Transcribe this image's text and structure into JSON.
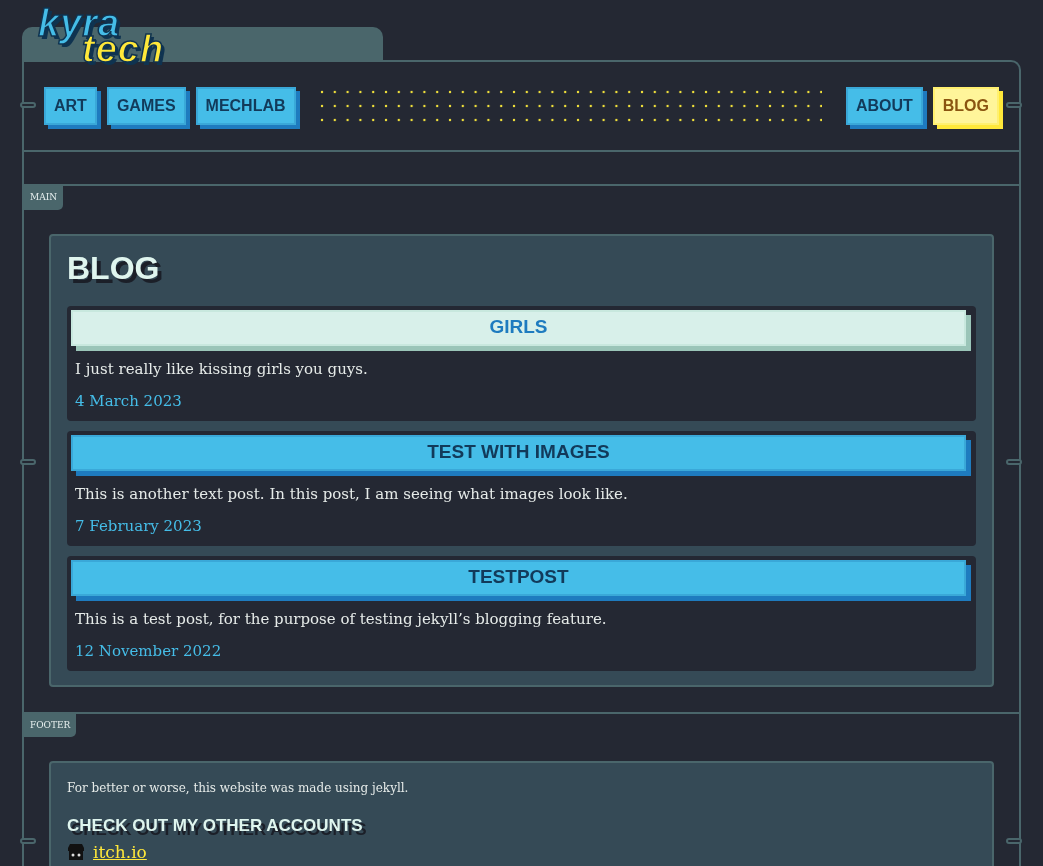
{
  "logo": {
    "line_1": "kyra",
    "line_2": "tech"
  },
  "nav": {
    "left": [
      {
        "label": "ART",
        "selected": false
      },
      {
        "label": "GAMES",
        "selected": false
      },
      {
        "label": "MECHLAB",
        "selected": false
      }
    ],
    "right": [
      {
        "label": "ABOUT",
        "selected": false
      },
      {
        "label": "BLOG",
        "selected": true
      }
    ]
  },
  "main": {
    "section_label": "MAIN",
    "title": "BLOG",
    "posts": [
      {
        "title": "GIRLS",
        "highlighted": true,
        "excerpt": "I just really like kissing girls you guys.",
        "date": "4 March 2023"
      },
      {
        "title": "TEST WITH IMAGES",
        "highlighted": false,
        "excerpt": "This is another text post. In this post, I am seeing what images look like.",
        "date": "7 February 2023"
      },
      {
        "title": "TESTPOST",
        "highlighted": false,
        "excerpt": "This is a test post, for the purpose of testing jekyll’s blogging feature.",
        "date": "12 November 2022"
      }
    ]
  },
  "footer": {
    "section_label": "FOOTER",
    "note": "For better or worse, this website was made using jekyll.",
    "heading": "CHECK OUT MY OTHER ACCOUNTS",
    "links": [
      {
        "label": "itch.io"
      }
    ]
  }
}
